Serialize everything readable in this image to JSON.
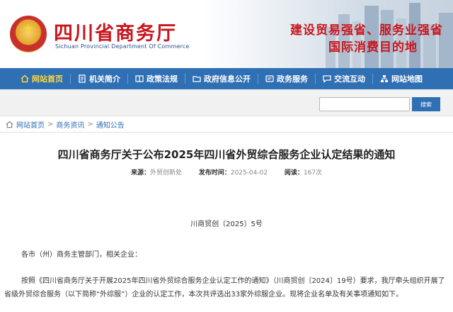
{
  "header": {
    "title": "四川省商务厅",
    "subtitle": "Sichuan Provincial Department Of Commerce",
    "slogan_line1": "建设贸易强省、服务业强省",
    "slogan_line2": "国际消费目的地"
  },
  "nav": {
    "items": [
      {
        "label": "网站首页",
        "icon": "home-icon"
      },
      {
        "label": "机关简介",
        "icon": "document-icon"
      },
      {
        "label": "政策法规",
        "icon": "book-icon"
      },
      {
        "label": "政府信息公开",
        "icon": "folder-icon"
      },
      {
        "label": "政务服务",
        "icon": "service-icon"
      },
      {
        "label": "交流互动",
        "icon": "chat-icon"
      },
      {
        "label": "网站地图",
        "icon": "sitemap-icon"
      }
    ]
  },
  "search": {
    "placeholder": "",
    "button_label": "搜索"
  },
  "breadcrumb": [
    "网站首页",
    "商务资讯",
    "通知公告"
  ],
  "article": {
    "title": "四川省商务厅关于公布2025年四川省外贸综合服务企业认定结果的通知",
    "source_label": "来源：",
    "source_value": "外贸创新处",
    "date_label": "发布时间：",
    "date_value": "2025-04-02",
    "views_label": "阅读：",
    "views_value": "167次",
    "doc_number": "川商贸创〔2025〕5号",
    "addressee": "各市（州）商务主管部门，相关企业：",
    "paragraph": "按照《四川省商务厅关于开展2025年四川省外贸综合服务企业认定工作的通知》（川商贸创〔2024〕19号）要求，我厅牵头组织开展了省级外贸综合服务（以下简称“外综服”）企业的认定工作，本次共评选出33家外综服企业。现将企业名单及有关事项通知如下。"
  },
  "colors": {
    "brand_red": "#c8161d",
    "nav_blue": "#2f6fb3",
    "nav_active": "#ffd83a"
  }
}
